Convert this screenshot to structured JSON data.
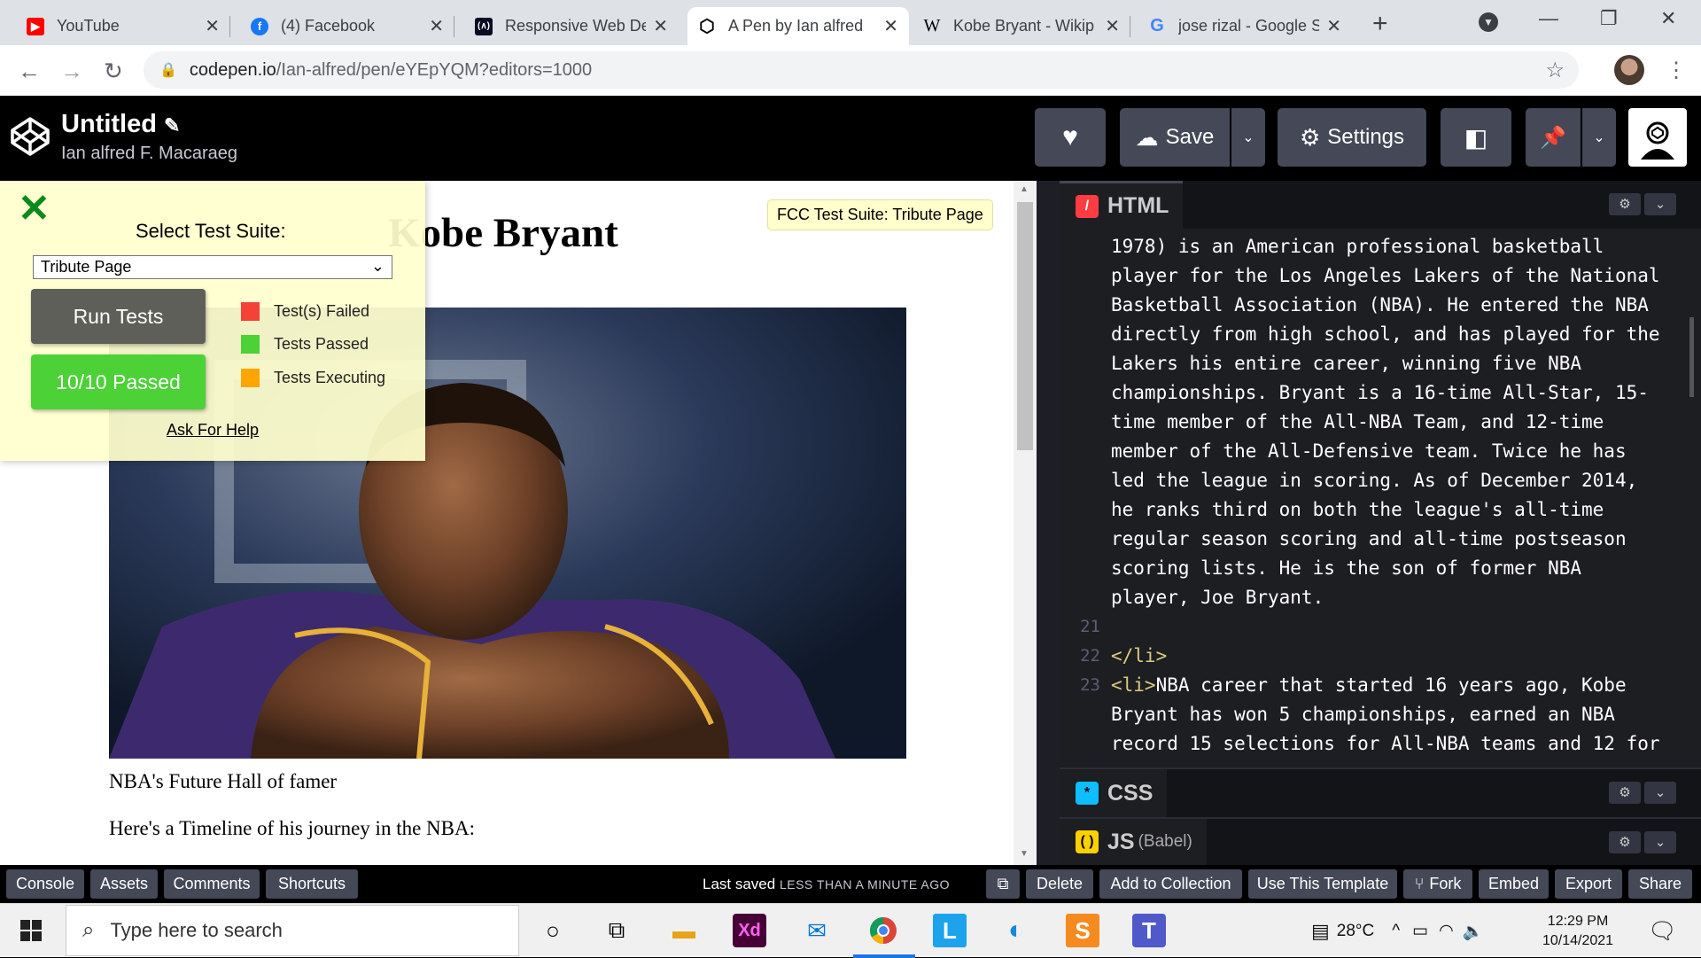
{
  "browser": {
    "tabs": [
      {
        "title": "YouTube",
        "icon": "youtube-icon",
        "color": "#ff0000"
      },
      {
        "title": "(4) Facebook",
        "icon": "facebook-icon",
        "color": "#1877f2"
      },
      {
        "title": "Responsive Web De",
        "icon": "fcc-icon",
        "color": "#0a0a23"
      },
      {
        "title": "A Pen by Ian alfred",
        "icon": "codepen-icon",
        "color": "#000000"
      },
      {
        "title": "Kobe Bryant - Wikip",
        "icon": "wikipedia-icon",
        "color": "#000000"
      },
      {
        "title": "jose rizal - Google S",
        "icon": "google-icon",
        "color": "#4285f4"
      }
    ],
    "url_host": "codepen.io",
    "url_path": "/Ian-alfred/pen/eYEpYQM?editors=1000"
  },
  "codepen": {
    "title": "Untitled",
    "author": "Ian alfred F. Macaraeg",
    "save_label": "Save",
    "settings_label": "Settings"
  },
  "preview": {
    "heading": "Kobe Bryant",
    "caption": "NBA's Future Hall of famer",
    "timeline_intro": "Here's a Timeline of his journey in the NBA:",
    "fcc_badge": "FCC Test Suite: Tribute Page"
  },
  "fcc": {
    "select_label": "Select Test Suite:",
    "selected_suite": "Tribute Page",
    "run_tests": "Run Tests",
    "result": "10/10 Passed",
    "legend": [
      {
        "label": "Test(s) Failed",
        "color": "#f44336"
      },
      {
        "label": "Tests Passed",
        "color": "#4cd137"
      },
      {
        "label": "Tests Executing",
        "color": "#ffa500"
      }
    ],
    "help": "Ask For Help"
  },
  "editor": {
    "html_tab": "HTML",
    "css_tab": "CSS",
    "js_tab": "JS",
    "js_sub": "(Babel)",
    "lines": [
      {
        "num": "",
        "text": "1978) is an American professional basketball"
      },
      {
        "num": "",
        "text": "player for the Los Angeles Lakers of the National"
      },
      {
        "num": "",
        "text": "Basketball Association (NBA). He entered the NBA"
      },
      {
        "num": "",
        "text": "directly from high school, and has played for the"
      },
      {
        "num": "",
        "text": "Lakers his entire career, winning five NBA"
      },
      {
        "num": "",
        "text": "championships. Bryant is a 16-time All-Star, 15-"
      },
      {
        "num": "",
        "text": "time member of the All-NBA Team, and 12-time"
      },
      {
        "num": "",
        "text": "member of the All-Defensive team. Twice he has"
      },
      {
        "num": "",
        "text": "led the league in scoring. As of December 2014,"
      },
      {
        "num": "",
        "text": "he ranks third on both the league's all-time"
      },
      {
        "num": "",
        "text": "regular season scoring and all-time postseason"
      },
      {
        "num": "",
        "text": "scoring lists. He is the son of former NBA"
      },
      {
        "num": "",
        "text": "player, Joe Bryant."
      },
      {
        "num": "21",
        "text": ""
      },
      {
        "num": "22",
        "text": "</li>"
      },
      {
        "num": "23",
        "text": "<li>NBA career that started 16 years ago, Kobe"
      },
      {
        "num": "",
        "text": "Bryant has won 5 championships, earned an NBA"
      },
      {
        "num": "",
        "text": "record 15 selections for All-NBA teams and 12 for"
      }
    ]
  },
  "footer": {
    "left": [
      "Console",
      "Assets",
      "Comments",
      "Shortcuts"
    ],
    "last_saved": "Last saved",
    "last_saved_time": "LESS THAN A MINUTE AGO",
    "right": [
      "Delete",
      "Add to Collection",
      "Use This Template",
      "Fork",
      "Embed",
      "Export",
      "Share"
    ]
  },
  "taskbar": {
    "search_placeholder": "Type here to search",
    "temperature": "28°C",
    "time": "12:29 PM",
    "date": "10/14/2021"
  }
}
